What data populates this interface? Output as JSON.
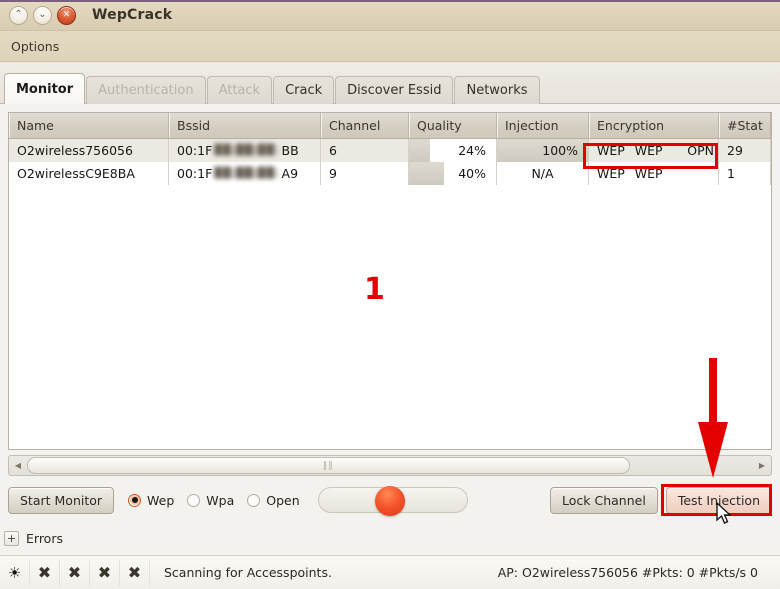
{
  "window": {
    "title": "WepCrack",
    "buttons": [
      {
        "name": "maximize-button",
        "glyph": "⌃"
      },
      {
        "name": "minimize-button",
        "glyph": "⌄"
      },
      {
        "name": "close-button",
        "glyph": "✕"
      }
    ]
  },
  "menubar": {
    "items": [
      {
        "label": "Options"
      }
    ]
  },
  "tabs": [
    {
      "label": "Monitor",
      "state": "active"
    },
    {
      "label": "Authentication",
      "state": "disabled"
    },
    {
      "label": "Attack",
      "state": "disabled"
    },
    {
      "label": "Crack",
      "state": "normal"
    },
    {
      "label": "Discover Essid",
      "state": "normal"
    },
    {
      "label": "Networks",
      "state": "normal"
    }
  ],
  "table": {
    "columns": [
      "Name",
      "Bssid",
      "Channel",
      "Quality",
      "Injection",
      "Encryption",
      "#Stat"
    ],
    "rows": [
      {
        "name": "O2wireless756056",
        "bssid_prefix": "00:1F",
        "bssid_redacted": "██:██:██:",
        "bssid_suffix": "BB",
        "channel": "6",
        "quality": "24%",
        "quality_pct": 24,
        "injection": "100%",
        "injection_pct": 100,
        "encryption": [
          "WEP",
          "WEP",
          "OPN"
        ],
        "stat": "29",
        "selected": true
      },
      {
        "name": "O2wirelessC9E8BA",
        "bssid_prefix": "00:1F",
        "bssid_redacted": "██:██:██:",
        "bssid_suffix": "A9",
        "channel": "9",
        "quality": "40%",
        "quality_pct": 40,
        "injection": "N/A",
        "injection_pct": 0,
        "encryption": [
          "WEP",
          "WEP"
        ],
        "stat": "1",
        "selected": false
      }
    ]
  },
  "scrollbar": {
    "left_arrow": "◀",
    "right_arrow": "▶",
    "grip": "‖‖"
  },
  "controls": {
    "start_monitor": "Start Monitor",
    "radios": [
      {
        "label": "Wep",
        "selected": true
      },
      {
        "label": "Wpa",
        "selected": false
      },
      {
        "label": "Open",
        "selected": false
      }
    ],
    "lock_channel": "Lock Channel",
    "test_injection": "Test Injection"
  },
  "expander": {
    "plus": "+",
    "label": "Errors"
  },
  "statusbar": {
    "icons": [
      {
        "name": "activity-sun-icon",
        "glyph": "☀"
      },
      {
        "name": "status-cross-icon-1",
        "glyph": "✖"
      },
      {
        "name": "status-cross-icon-2",
        "glyph": "✖"
      },
      {
        "name": "status-cross-icon-3",
        "glyph": "✖"
      },
      {
        "name": "status-cross-icon-4",
        "glyph": "✖"
      }
    ],
    "message": "Scanning for Accesspoints.",
    "info": "AP: O2wireless756056  #Pkts: 0  #Pkts/s 0"
  },
  "annotations": {
    "step_number": "1",
    "highlight_color": "#e50000",
    "arrow_color": "#e50000"
  }
}
